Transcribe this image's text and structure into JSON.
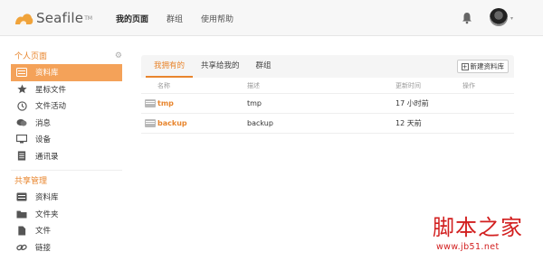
{
  "app": {
    "logo_text": "Seafile",
    "logo_tm": "TM",
    "accent": "#e8852d"
  },
  "topnav": {
    "items": [
      {
        "label": "我的页面",
        "active": true
      },
      {
        "label": "群组",
        "active": false
      },
      {
        "label": "使用帮助",
        "active": false
      }
    ],
    "bell_icon": "bell-icon",
    "avatar_caret": "▾"
  },
  "sidebar": {
    "personal_title": "个人页面",
    "settings_icon": "gear-icon",
    "personal_items": [
      {
        "label": "资料库",
        "icon": "library-icon",
        "active": true
      },
      {
        "label": "星标文件",
        "icon": "star-icon",
        "active": false
      },
      {
        "label": "文件活动",
        "icon": "clock-icon",
        "active": false
      },
      {
        "label": "消息",
        "icon": "message-icon",
        "active": false
      },
      {
        "label": "设备",
        "icon": "monitor-icon",
        "active": false
      },
      {
        "label": "通讯录",
        "icon": "contacts-icon",
        "active": false
      }
    ],
    "shared_title": "共享管理",
    "shared_items": [
      {
        "label": "资料库",
        "icon": "library-icon"
      },
      {
        "label": "文件夹",
        "icon": "folder-icon"
      },
      {
        "label": "文件",
        "icon": "file-icon"
      },
      {
        "label": "链接",
        "icon": "link-icon"
      }
    ]
  },
  "main": {
    "tabs": [
      {
        "label": "我拥有的",
        "active": true
      },
      {
        "label": "共享给我的",
        "active": false
      },
      {
        "label": "群组",
        "active": false
      }
    ],
    "new_library_button": "新建资料库",
    "columns": {
      "name": "名称",
      "desc": "描述",
      "time": "更新时间",
      "ops": "操作"
    },
    "rows": [
      {
        "name": "tmp",
        "desc": "tmp",
        "time": "17 小时前"
      },
      {
        "name": "backup",
        "desc": "backup",
        "time": "12 天前"
      }
    ]
  },
  "watermark": {
    "big": "脚本之家",
    "small": "www.jb51.net"
  }
}
